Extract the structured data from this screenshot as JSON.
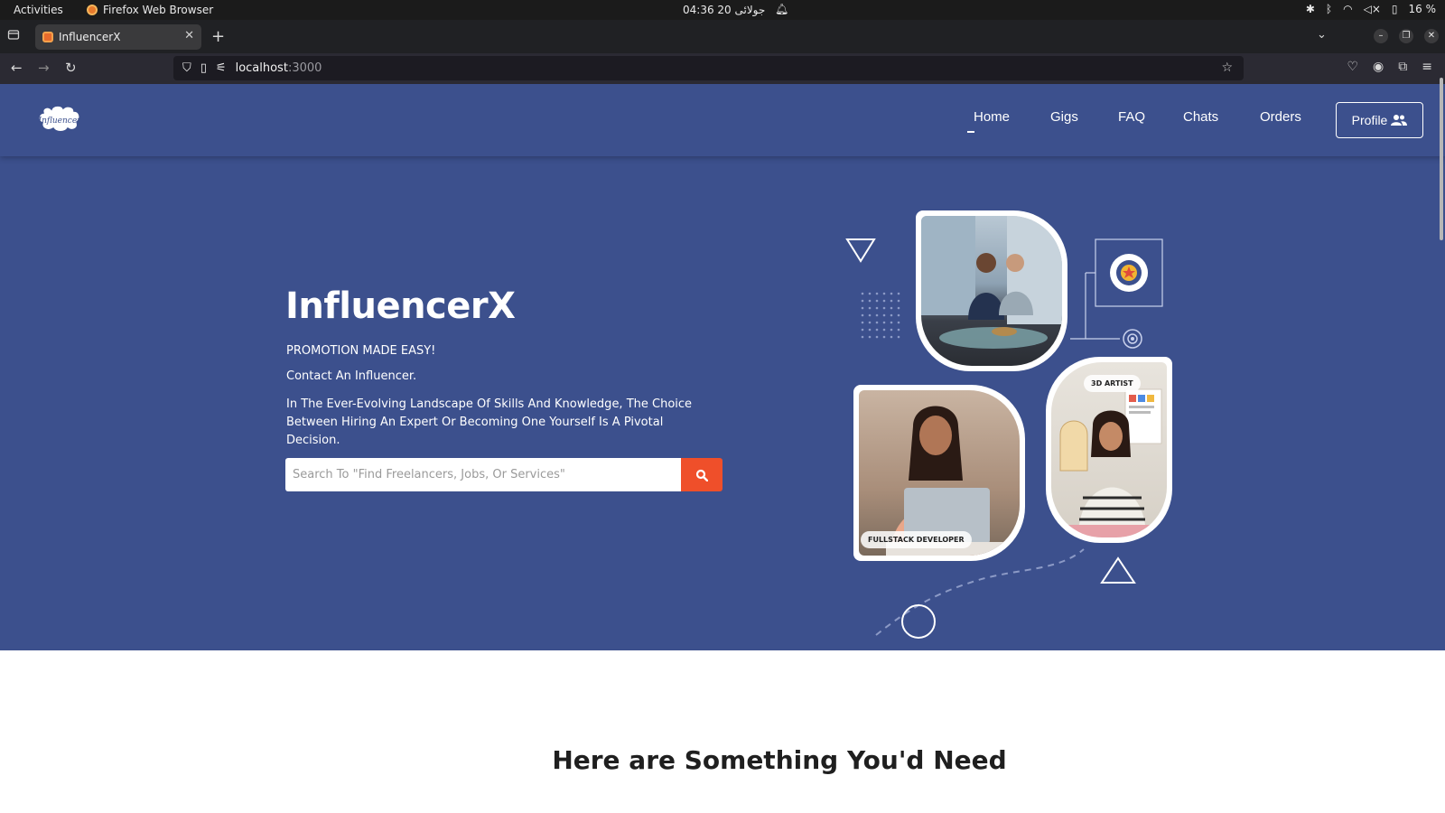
{
  "os": {
    "activities": "Activities",
    "app_name": "Firefox Web Browser",
    "clock": "04:36  20 جولائی",
    "battery": "16 %"
  },
  "browser": {
    "tab_title": "InfluencerX",
    "url_host": "localhost",
    "url_port": ":3000"
  },
  "site": {
    "logo_text": "Influencer",
    "nav": [
      "Home",
      "Gigs",
      "FAQ",
      "Chats",
      "Orders"
    ],
    "profile_label": "Profile"
  },
  "hero": {
    "title": "InfluencerX",
    "tagline": "PROMOTION MADE EASY!",
    "contact": "Contact An Influencer.",
    "description": "In The Ever-Evolving Landscape Of Skills And Knowledge, The Choice Between Hiring An Expert Or Becoming One Yourself Is A Pivotal Decision.",
    "search_placeholder": "Search To \"Find Freelancers, Jobs, Or Services\"",
    "label_developer": "FULLSTACK DEVELOPER",
    "label_artist": "3D ARTIST"
  },
  "section": {
    "title": "Here are Something You'd Need"
  },
  "colors": {
    "brand_blue": "#3c508d",
    "accent_orange": "#ef4f2a"
  }
}
